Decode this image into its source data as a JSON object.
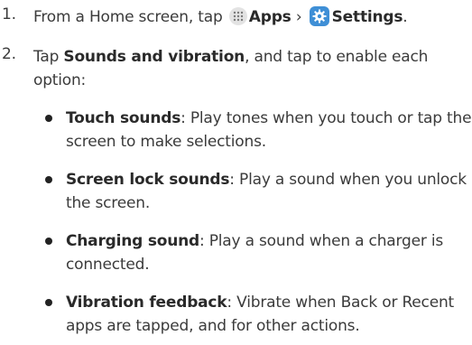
{
  "steps": [
    {
      "number": "1.",
      "pre": "From a Home screen, tap",
      "apps": "Apps",
      "sep": "›",
      "settings": "Settings",
      "end": "."
    },
    {
      "number": "2.",
      "pre": "Tap",
      "bold": "Sounds and vibration",
      "post": ", and tap to enable each option:"
    }
  ],
  "bullets": [
    {
      "term": "Touch sounds",
      "desc": ": Play tones when you touch or tap the screen to make selections."
    },
    {
      "term": "Screen lock sounds",
      "desc": ": Play a sound when you unlock the screen."
    },
    {
      "term": "Charging sound",
      "desc": ": Play a sound when a charger is connected."
    },
    {
      "term": "Vibration feedback",
      "desc": ": Vibrate when Back or Recent apps are tapped, and for other actions."
    }
  ],
  "icons": {
    "apps": "apps-grid-icon",
    "settings": "settings-gear-icon"
  },
  "colors": {
    "settings_icon_bg": "#3f8fd6",
    "text": "#3b3b3b"
  }
}
